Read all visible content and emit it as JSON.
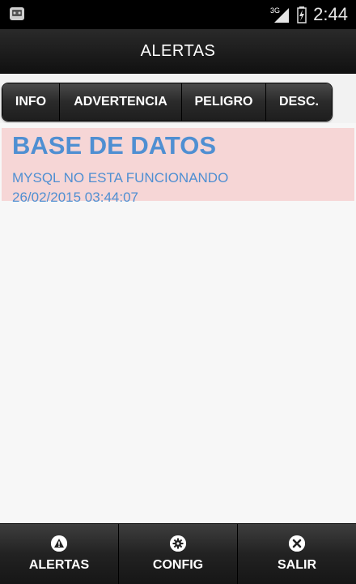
{
  "status_bar": {
    "network": "3G",
    "time": "2:44"
  },
  "action_bar": {
    "title": "ALERTAS"
  },
  "filters": [
    {
      "label": "INFO"
    },
    {
      "label": "ADVERTENCIA"
    },
    {
      "label": "PELIGRO"
    },
    {
      "label": "DESC."
    }
  ],
  "alerts": [
    {
      "title": "BASE DE DATOS",
      "message": "MYSQL NO ESTA FUNCIONANDO",
      "timestamp": "26/02/2015 03:44:07",
      "color": "#f6d6d6"
    }
  ],
  "tabs": [
    {
      "label": "ALERTAS",
      "icon": "warning-icon"
    },
    {
      "label": "CONFIG",
      "icon": "gear-icon"
    },
    {
      "label": "SALIR",
      "icon": "close-icon"
    }
  ],
  "colors": {
    "accent_text": "#4f8fd2",
    "alert_background": "#f6d6d6"
  }
}
